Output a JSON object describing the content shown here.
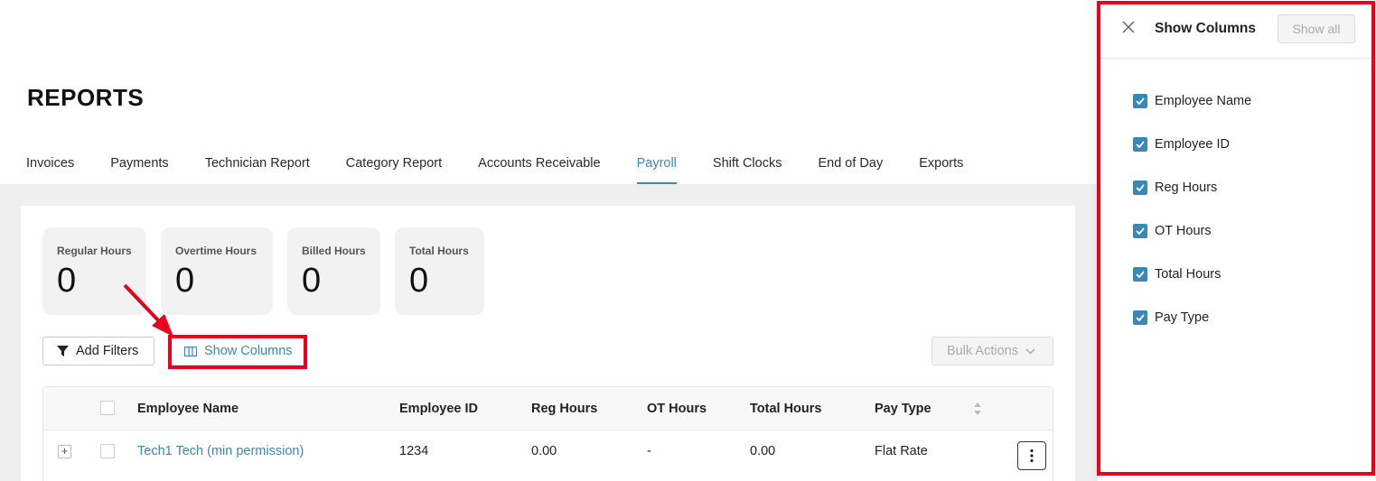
{
  "page": {
    "title": "REPORTS"
  },
  "tabs": [
    {
      "label": "Invoices"
    },
    {
      "label": "Payments"
    },
    {
      "label": "Technician Report"
    },
    {
      "label": "Category Report"
    },
    {
      "label": "Accounts Receivable"
    },
    {
      "label": "Payroll",
      "active": true
    },
    {
      "label": "Shift Clocks"
    },
    {
      "label": "End of Day"
    },
    {
      "label": "Exports"
    }
  ],
  "stats": [
    {
      "label": "Regular Hours",
      "value": "0"
    },
    {
      "label": "Overtime Hours",
      "value": "0"
    },
    {
      "label": "Billed Hours",
      "value": "0"
    },
    {
      "label": "Total Hours",
      "value": "0"
    }
  ],
  "toolbar": {
    "add_filters_label": "Add Filters",
    "show_columns_label": "Show Columns",
    "bulk_actions_label": "Bulk Actions",
    "filter_icon": "filter-icon",
    "columns_icon": "columns-icon"
  },
  "table": {
    "columns": [
      "Employee Name",
      "Employee ID",
      "Reg Hours",
      "OT Hours",
      "Total Hours",
      "Pay Type"
    ],
    "rows": [
      {
        "employee_name": "Tech1 Tech (min permission)",
        "employee_id": "1234",
        "reg_hours": "0.00",
        "ot_hours": "-",
        "total_hours": "0.00",
        "pay_type": "Flat Rate"
      }
    ]
  },
  "panel": {
    "title": "Show Columns",
    "show_all_label": "Show all",
    "columns": [
      {
        "label": "Employee Name",
        "checked": true
      },
      {
        "label": "Employee ID",
        "checked": true
      },
      {
        "label": "Reg Hours",
        "checked": true
      },
      {
        "label": "OT Hours",
        "checked": true
      },
      {
        "label": "Total Hours",
        "checked": true
      },
      {
        "label": "Pay Type",
        "checked": true
      }
    ]
  },
  "colors": {
    "accent": "#3a88b5",
    "highlight": "#e8001c",
    "background_gray": "#efefef"
  }
}
